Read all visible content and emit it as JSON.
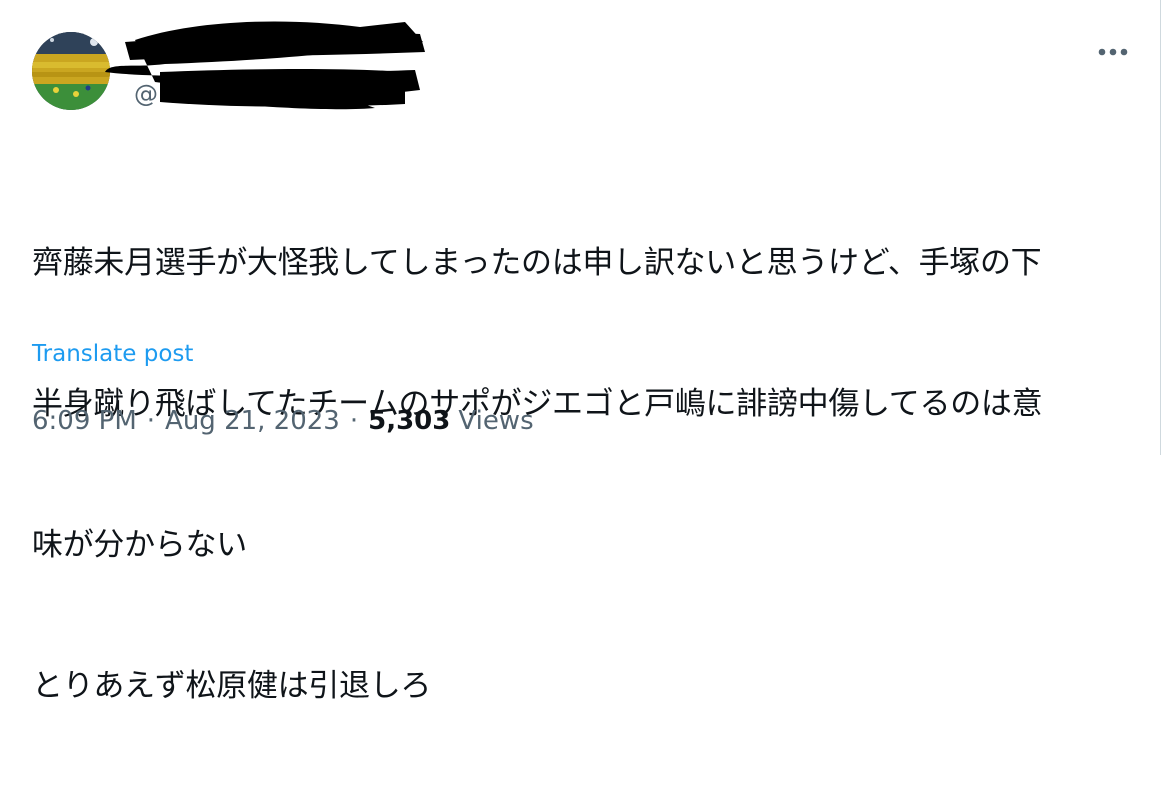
{
  "user": {
    "handle_prefix": "@"
  },
  "tweet": {
    "lines": [
      "齊藤未月選手が大怪我してしまったのは申し訳ないと思うけど、手塚の下",
      "半身蹴り飛ばしてたチームのサポがジエゴと戸嶋に誹謗中傷してるのは意",
      "味が分からない",
      "とりあえず松原健は引退しろ"
    ],
    "translate_label": "Translate post"
  },
  "meta": {
    "time": "6:09 PM",
    "separator": "·",
    "date": "Aug 21, 2023",
    "views_count": "5,303",
    "views_label": "Views"
  },
  "icons": {
    "more": "more-horizontal-icon"
  },
  "colors": {
    "text": "#0f1419",
    "secondary": "#536471",
    "link": "#1d9bf0",
    "border": "#cfd9de"
  }
}
